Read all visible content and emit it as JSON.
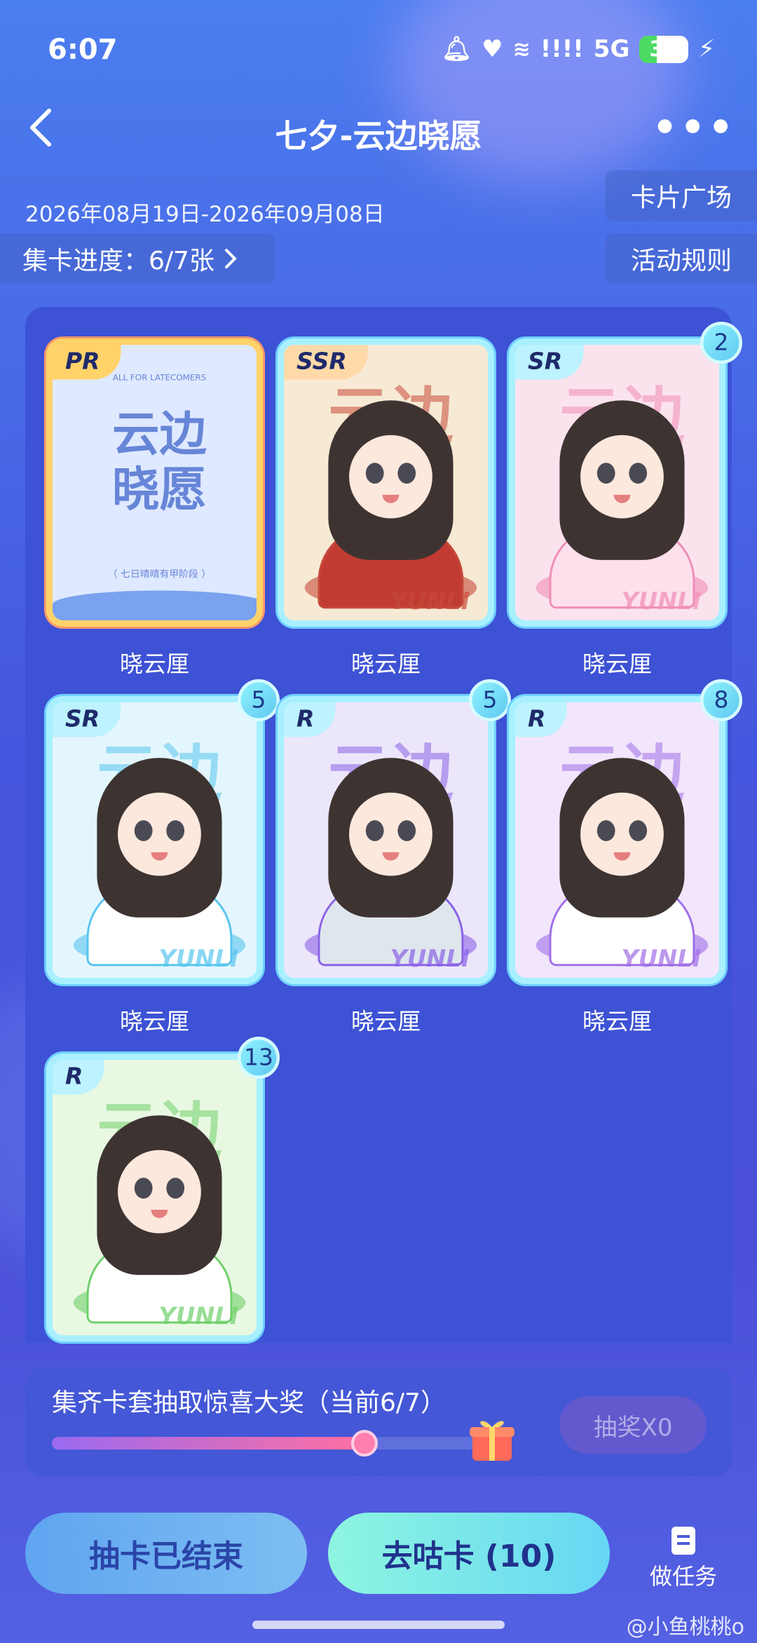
{
  "status": {
    "time": "6:07",
    "network": "5G",
    "battery": "35",
    "signal": "!!!!"
  },
  "header": {
    "title": "七夕-云边晓愿",
    "back_icon": "chevron-left-icon",
    "more_icon": "more-icon"
  },
  "event": {
    "date_range": "2026年08月19日-2026年09月08日",
    "progress_label": "集卡进度：6/7张",
    "card_plaza": "卡片广场",
    "rules": "活动规则"
  },
  "cards": [
    {
      "rarity": "PR",
      "label": "晓云厘",
      "count": null,
      "theme": "#dfe9ff",
      "accent": "#7aa2ef",
      "body": "#e9f0ff",
      "art_title": "云边\n晓愿",
      "art_foot": "（ 七日晴晴有甲阶段 ）",
      "art_top": "ALL FOR LATECOMERS"
    },
    {
      "rarity": "SSR",
      "label": "晓云厘",
      "count": null,
      "theme": "#f7ead4",
      "accent": "#c64a3a",
      "body": "#c23b32",
      "art_word": "云边",
      "art_sign": "YUNLI"
    },
    {
      "rarity": "SR",
      "label": "晓云厘",
      "count": "2",
      "theme": "#fbe3ee",
      "accent": "#f08db8",
      "body": "#fde0ec",
      "art_word": "云边",
      "art_sign": "YUNLI"
    },
    {
      "rarity": "SR",
      "label": "晓云厘",
      "count": "5",
      "theme": "#e4f6fd",
      "accent": "#58c5ef",
      "body": "#ffffff",
      "art_word": "云边",
      "art_sign": "YUNLI"
    },
    {
      "rarity": "R",
      "label": "晓云厘",
      "count": "5",
      "theme": "#ece6fb",
      "accent": "#8a63e6",
      "body": "#dfe6ee",
      "art_word": "云边",
      "art_sign": "YUNLI"
    },
    {
      "rarity": "R",
      "label": "晓云厘",
      "count": "8",
      "theme": "#f1e6fb",
      "accent": "#a06ee8",
      "body": "#ffffff",
      "art_word": "云边",
      "art_sign": "YUNLI"
    },
    {
      "rarity": "R",
      "label": "晓云厘",
      "count": "13",
      "theme": "#e9f8e3",
      "accent": "#6fd06a",
      "body": "#ffffff",
      "art_word": "云边",
      "art_sign": "YUNLI"
    }
  ],
  "prize": {
    "text": "集齐卡套抽取惊喜大奖（当前6/7）",
    "progress_fraction": 0.857,
    "draw_label": "抽奖X0",
    "gift_icon": "gift-icon"
  },
  "actions": {
    "ended_label": "抽卡已结束",
    "gu_label": "去咕卡 (10)",
    "task_label": "做任务",
    "task_icon": "document-icon"
  },
  "watermark": "@小鱼桃桃o"
}
